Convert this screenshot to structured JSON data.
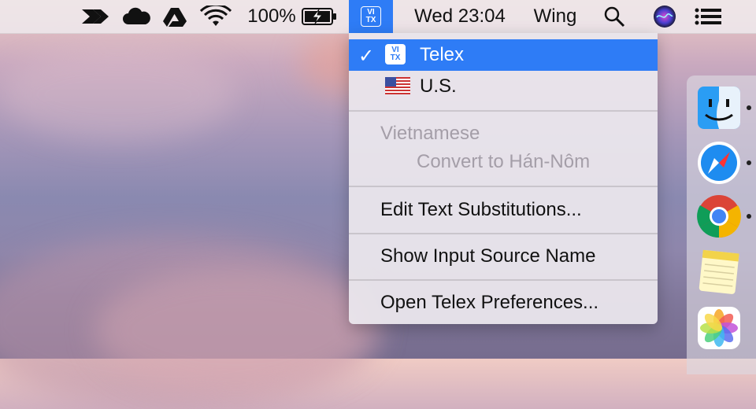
{
  "menubar": {
    "battery_percent": "100%",
    "clock": "Wed 23:04",
    "user": "Wing",
    "input_badge_top": "VI",
    "input_badge_bottom": "TX"
  },
  "dropdown": {
    "items": [
      {
        "label": "Telex",
        "checked": true,
        "selected": true,
        "icon": "telex-input-icon"
      },
      {
        "label": "U.S.",
        "checked": false,
        "icon": "us-flag-icon"
      },
      {
        "label": "Vietnamese",
        "disabled": true
      },
      {
        "label": "Convert to Hán-Nôm",
        "disabled": true
      },
      {
        "label": "Edit Text Substitutions..."
      },
      {
        "label": "Show Input Source Name"
      },
      {
        "label": "Open Telex Preferences..."
      }
    ]
  },
  "dock": {
    "apps": [
      "Finder",
      "Safari",
      "Chrome",
      "Notes",
      "Photos"
    ]
  },
  "colors": {
    "accent": "#2e7cf6"
  }
}
